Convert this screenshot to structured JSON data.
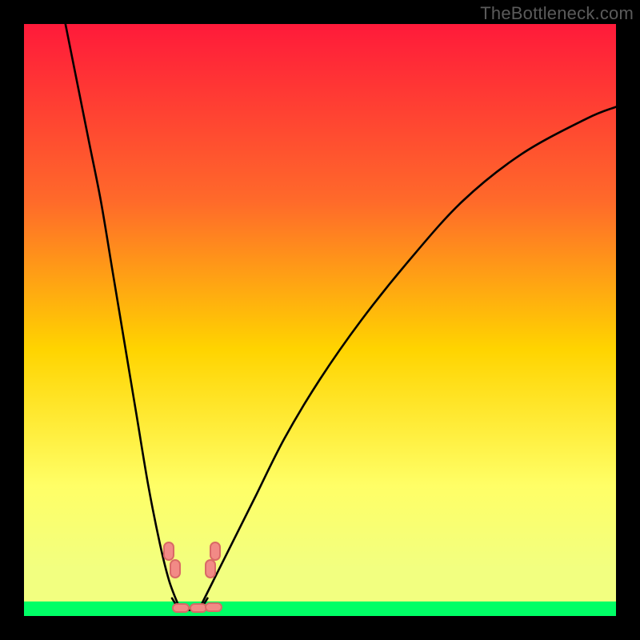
{
  "watermark": "TheBottleneck.com",
  "chart_data": {
    "type": "line",
    "title": "",
    "xlabel": "",
    "ylabel": "",
    "xlim": [
      0,
      100
    ],
    "ylim": [
      0,
      100
    ],
    "grid": false,
    "legend": false,
    "gradient": {
      "top_color": "#ff1a3a",
      "mid_color": "#ffd400",
      "low_color": "#f2ff80",
      "band_color": "#00ff66",
      "band_start_pct": 97.5,
      "band_end_pct": 100
    },
    "series": [
      {
        "name": "left-branch",
        "x": [
          7,
          9,
          11,
          13,
          15,
          17,
          19,
          21,
          23,
          24.5,
          26
        ],
        "y": [
          100,
          90,
          80,
          70,
          58,
          46,
          34,
          22,
          12,
          6,
          2
        ]
      },
      {
        "name": "right-branch",
        "x": [
          30,
          32,
          35,
          39,
          44,
          50,
          57,
          65,
          74,
          84,
          95,
          100
        ],
        "y": [
          2,
          6,
          12,
          20,
          30,
          40,
          50,
          60,
          70,
          78,
          84,
          86
        ]
      },
      {
        "name": "valley-floor",
        "x": [
          25,
          26,
          27,
          28,
          29,
          30,
          31
        ],
        "y": [
          3,
          1.5,
          1,
          1,
          1,
          1.5,
          3
        ]
      }
    ],
    "markers": [
      {
        "x": 24.5,
        "y": 11,
        "shape": "pill-vert"
      },
      {
        "x": 25.6,
        "y": 8.0,
        "shape": "pill-vert"
      },
      {
        "x": 31.5,
        "y": 8.0,
        "shape": "pill-vert"
      },
      {
        "x": 32.3,
        "y": 11,
        "shape": "pill-vert"
      },
      {
        "x": 26.5,
        "y": 1.3,
        "shape": "pill-horz"
      },
      {
        "x": 29.5,
        "y": 1.3,
        "shape": "pill-horz"
      },
      {
        "x": 32.0,
        "y": 1.5,
        "shape": "pill-horz"
      }
    ]
  }
}
